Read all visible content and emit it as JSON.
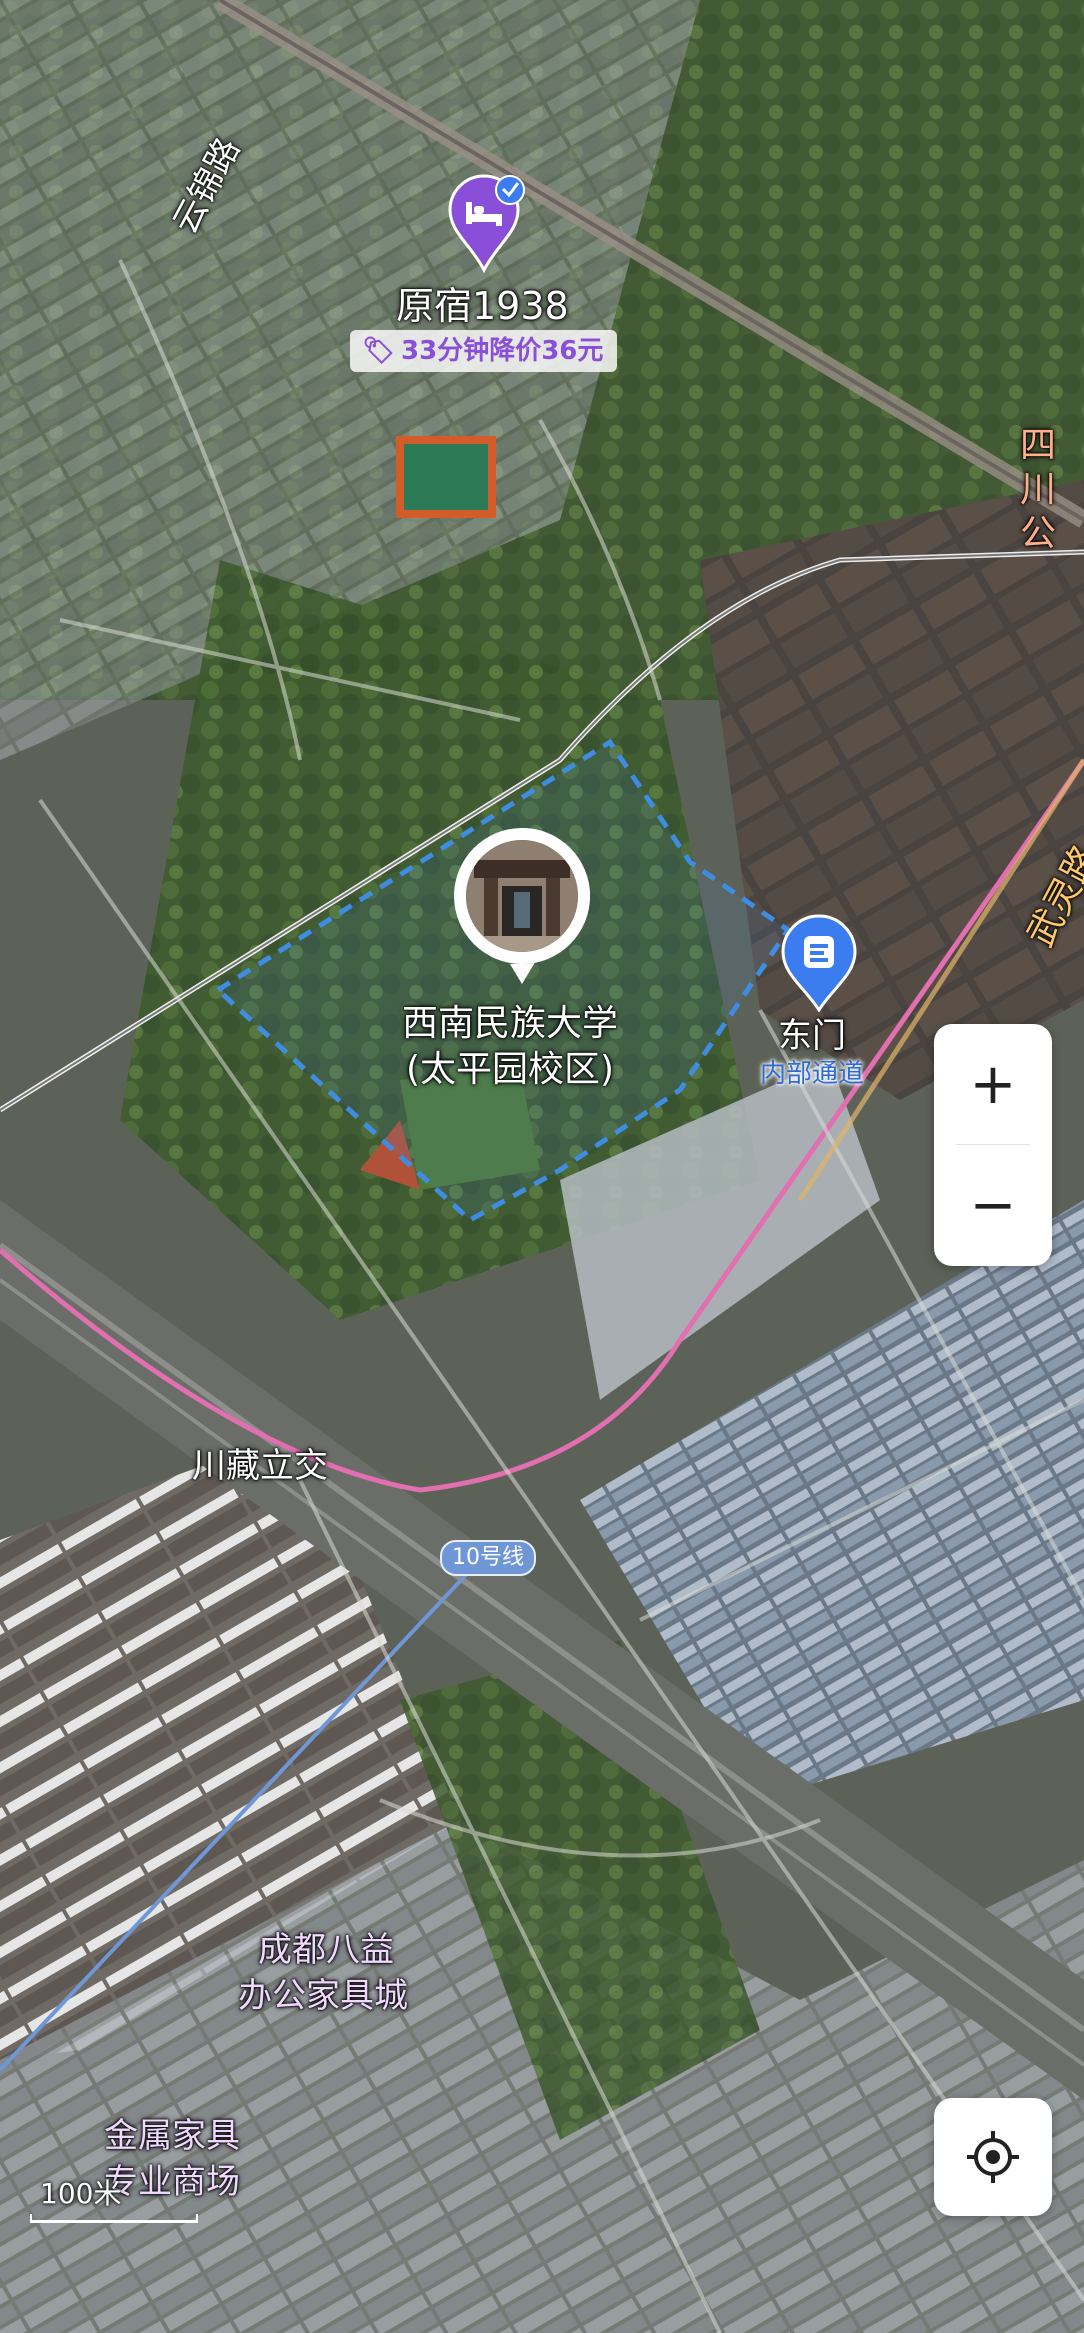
{
  "hotel": {
    "name": "原宿1938",
    "price_drop": "33分钟降价36元",
    "icon": "bed-icon",
    "badge_icon": "check-badge-icon",
    "color": "#8a4fd8"
  },
  "university": {
    "name_line1": "西南民族大学",
    "name_line2": "(太平园校区)",
    "icon": "campus-photo-marker"
  },
  "gate": {
    "name": "东门",
    "subtitle": "内部通道",
    "icon": "entrance-icon",
    "color": "#2f6bd6"
  },
  "roads": {
    "yunjin": "云锦路",
    "sichuan": "四川公",
    "lingjian": "武灵路",
    "interchange": "川藏立交"
  },
  "metro": {
    "line_label": "10号线",
    "color": "#6f97d6"
  },
  "pois": {
    "bayi_line1": "成都八益",
    "bayi_line2": "办公家具城",
    "metal_line1": "金属家具",
    "metal_line2": "专业商场"
  },
  "controls": {
    "zoom_in": "+",
    "zoom_out": "−",
    "locate_icon": "locate-crosshair-icon"
  },
  "scale": {
    "label": "100米"
  }
}
